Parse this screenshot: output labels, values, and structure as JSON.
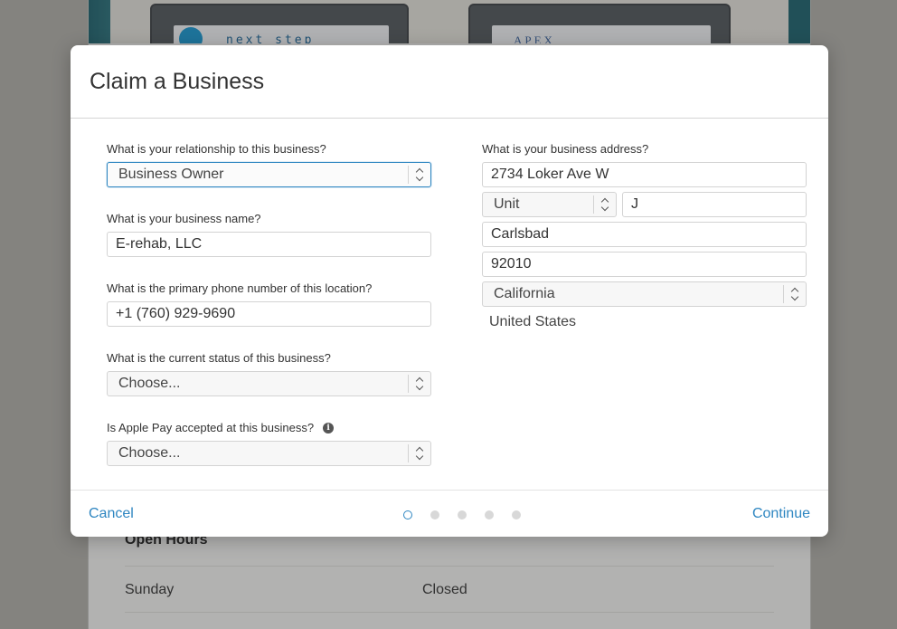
{
  "background": {
    "sign_left_text": "next step",
    "sign_right_text": "APEX",
    "section_title": "Open Hours",
    "hours": [
      {
        "day": "Sunday",
        "status": "Closed"
      }
    ]
  },
  "modal": {
    "title": "Claim a Business",
    "left": {
      "relationship": {
        "label": "What is your relationship to this business?",
        "value": "Business Owner"
      },
      "business_name": {
        "label": "What is your business name?",
        "value": "E-rehab, LLC"
      },
      "phone": {
        "label": "What is the primary phone number of this location?",
        "value": "+1 (760) 929-9690"
      },
      "status": {
        "label": "What is the current status of this business?",
        "value": "Choose..."
      },
      "apple_pay": {
        "label": "Is Apple Pay accepted at this business?",
        "value": "Choose..."
      }
    },
    "right": {
      "address_label": "What is your business address?",
      "street": "2734 Loker Ave W",
      "unit_type": "Unit",
      "unit_number": "J",
      "city": "Carlsbad",
      "zip": "92010",
      "state": "California",
      "country": "United States"
    },
    "footer": {
      "cancel_label": "Cancel",
      "continue_label": "Continue",
      "steps_total": 5,
      "current_step": 1
    }
  },
  "colors": {
    "accent": "#2e86c1"
  }
}
